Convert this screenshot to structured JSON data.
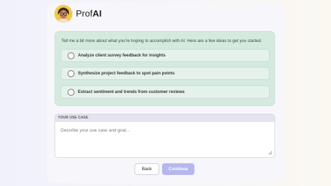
{
  "brand": {
    "name_prefix": "Prof",
    "name_suffix": "AI"
  },
  "ideas": {
    "intro": "Tell me a bit more about what you're hoping to accomplish with AI. Here are a few ideas to get you started.",
    "options": [
      {
        "label": "Analyze client survey feedback for insights"
      },
      {
        "label": "Synthesize project feedback to spot pain points"
      },
      {
        "label": "Extract sentiment and trends from customer reviews"
      }
    ]
  },
  "use_case": {
    "heading": "YOUR USE CASE",
    "placeholder": "Describe your use case and goal..."
  },
  "actions": {
    "back_label": "Back",
    "continue_label": "Continue"
  },
  "colors": {
    "accent": "#b7b7ef",
    "ideas_panel": "#d5eadf",
    "avatar_bg": "#f3c84a"
  }
}
